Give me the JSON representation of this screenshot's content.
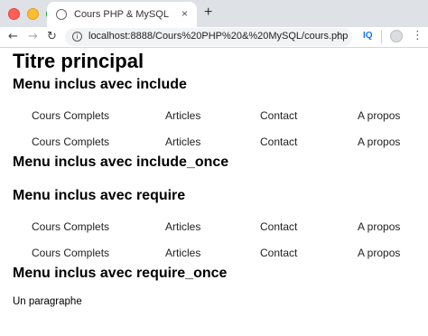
{
  "browser": {
    "tab_title": "Cours PHP & MySQL",
    "tab_close": "×",
    "new_tab": "+",
    "url": "localhost:8888/Cours%20PHP%20&%20MySQL/cours.php",
    "extension_label": "IQ",
    "nav": {
      "back": "←",
      "forward": "→",
      "reload": "↻",
      "info": "i",
      "star": "☆",
      "menu": "⋮"
    }
  },
  "page": {
    "title": "Titre principal",
    "headings": [
      "Menu inclus avec include",
      "Menu inclus avec include_once",
      "Menu inclus avec require",
      "Menu inclus avec require_once"
    ],
    "menu": [
      "Cours Complets",
      "Articles",
      "Contact",
      "A propos"
    ],
    "paragraph": "Un paragraphe"
  }
}
